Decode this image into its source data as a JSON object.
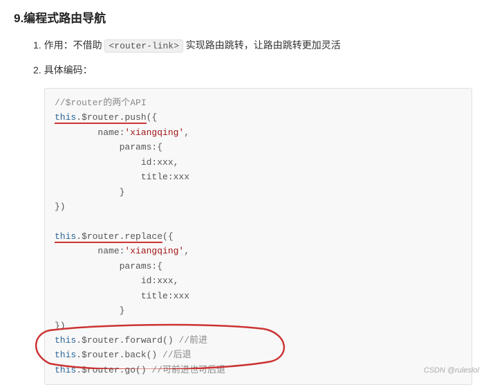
{
  "heading": "9.编程式路由导航",
  "item1": {
    "prefix": "1. 作用：不借助 ",
    "code": "<router-link>",
    "suffix": " 实现路由跳转，让路由跳转更加灵活"
  },
  "item2": "2. 具体编码：",
  "code": {
    "c01": "//$router的两个API",
    "c02a": "this",
    "c02b": ".$router.push",
    "c02c": "({",
    "c03": "        name:",
    "c03s": "'xiangqing'",
    "c03e": ",",
    "c04": "            params:{",
    "c05": "                id:xxx,",
    "c06": "                title:xxx",
    "c07": "            }",
    "c08": "})",
    "c09": "",
    "c10a": "this",
    "c10b": ".$router.replace",
    "c10c": "({",
    "c11": "        name:",
    "c11s": "'xiangqing'",
    "c11e": ",",
    "c12": "            params:{",
    "c13": "                id:xxx,",
    "c14": "                title:xxx",
    "c15": "            }",
    "c16": "})",
    "c17a": "this",
    "c17b": ".$router.forward() ",
    "c17c": "//前进",
    "c18a": "this",
    "c18b": ".$router.back() ",
    "c18c": "//后退",
    "c19a": "this",
    "c19b": ".$router.go() ",
    "c19c": "//可前进也可后退"
  },
  "watermark": "CSDN @ruleslol"
}
